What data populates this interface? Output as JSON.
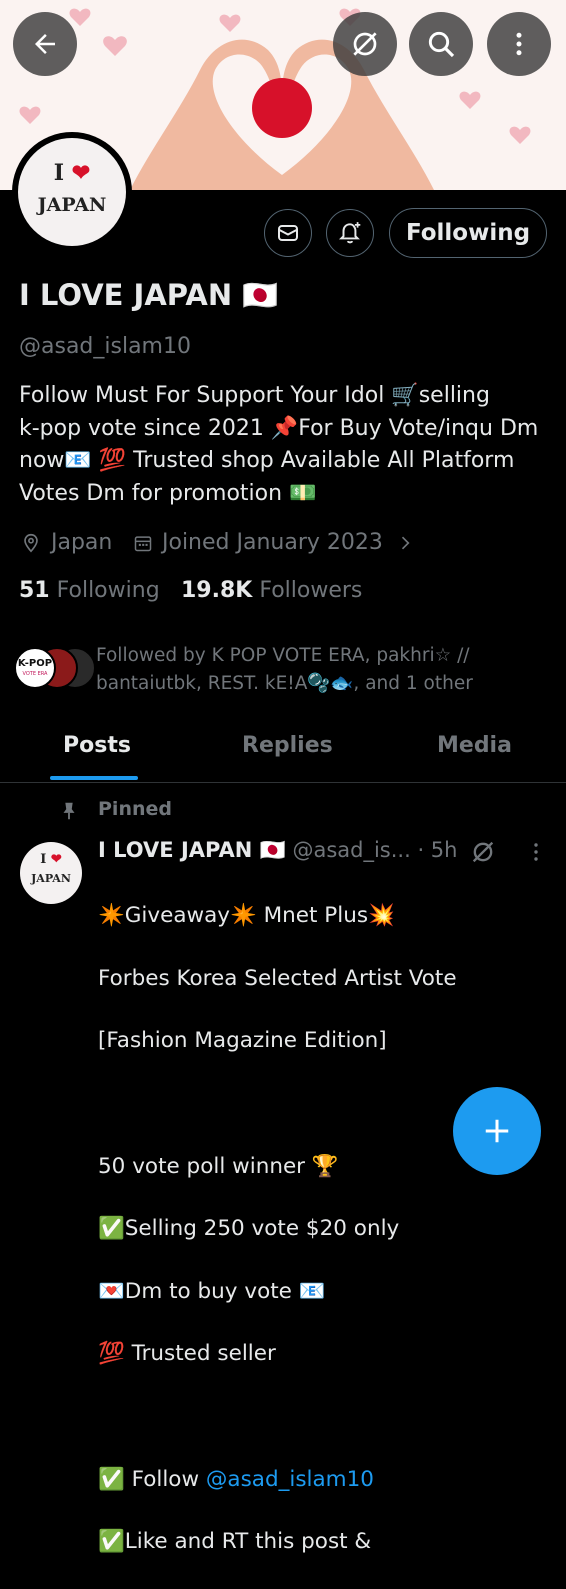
{
  "banner": {
    "logo_emoji": "🇯🇵"
  },
  "top_bar": {
    "back_icon": "arrow-left-icon",
    "grok_icon": "grok-icon",
    "search_icon": "search-icon",
    "more_icon": "more-vertical-icon"
  },
  "profile": {
    "avatar_line1": "I",
    "avatar_heart": "❤",
    "avatar_line2": "JAPAN",
    "display_name": "I LOVE JAPAN 🇯🇵",
    "handle": "@asad_islam10",
    "bio_lines": [
      "Follow Must For Support Your Idol 🛒selling",
      "k-pop vote since 2021 📌For Buy Vote/inqu Dm",
      "now📧 💯 Trusted shop Available All Platform",
      "Votes  Dm for promotion 💵"
    ],
    "location": "Japan",
    "joined": "Joined January 2023",
    "following_count": "51",
    "following_label": "Following",
    "followers_count": "19.8K",
    "followers_label": "Followers",
    "followed_by_line1": "Followed by K POP VOTE ERA, pakhri☆ //",
    "followed_by_line2": "bantaiutbk, REST. kE!A🫧🐟, and 1 other",
    "follow_button": "Following",
    "kpop_avatar_text": "K-POP",
    "kpop_avatar_sub": "VOTE ERA"
  },
  "tabs": [
    "Posts",
    "Replies",
    "Media"
  ],
  "post": {
    "pinned_label": "Pinned",
    "author": "I LOVE JAPAN 🇯🇵",
    "handle_time": "@asad_is... · 5h",
    "lines": [
      "✴️Giveaway✴️  Mnet Plus💥",
      "Forbes Korea Selected Artist Vote",
      "[Fashion Magazine Edition]",
      "",
      "50 vote poll winner 🏆",
      "✅Selling 250 vote $20 only",
      "💌Dm to buy vote 📧",
      "💯 Trusted seller",
      "",
      "✅ Follow ",
      "✅Like and RT this post &"
    ],
    "mention": "@asad_islam10"
  },
  "colors": {
    "accent": "#1d9bf0",
    "background": "#000000",
    "text": "#e7e9ea",
    "muted": "#71767b",
    "border": "#536471"
  }
}
